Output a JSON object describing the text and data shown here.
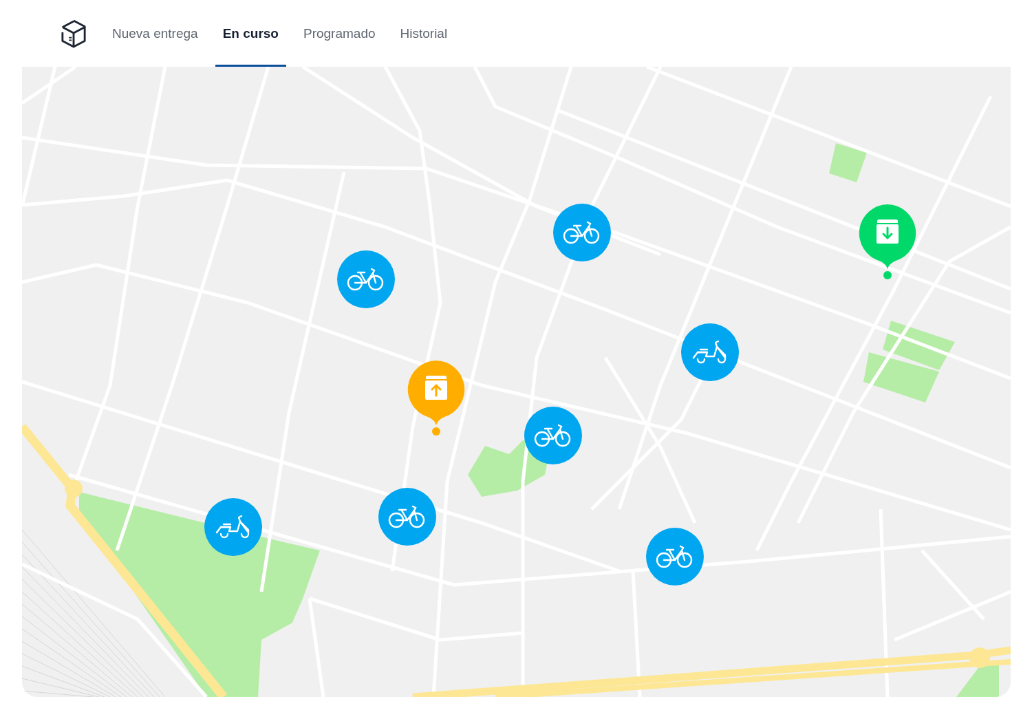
{
  "tabs": [
    {
      "label": "Nueva entrega",
      "selected": false
    },
    {
      "label": "En curso",
      "selected": true
    },
    {
      "label": "Programado",
      "selected": false
    },
    {
      "label": "Historial",
      "selected": false
    }
  ],
  "map": {
    "markers": [
      {
        "kind": "bike"
      },
      {
        "kind": "bike"
      },
      {
        "kind": "scooter"
      },
      {
        "kind": "bike"
      },
      {
        "kind": "bike"
      },
      {
        "kind": "scooter"
      },
      {
        "kind": "bike"
      },
      {
        "kind": "pickup"
      },
      {
        "kind": "dropoff"
      }
    ]
  }
}
